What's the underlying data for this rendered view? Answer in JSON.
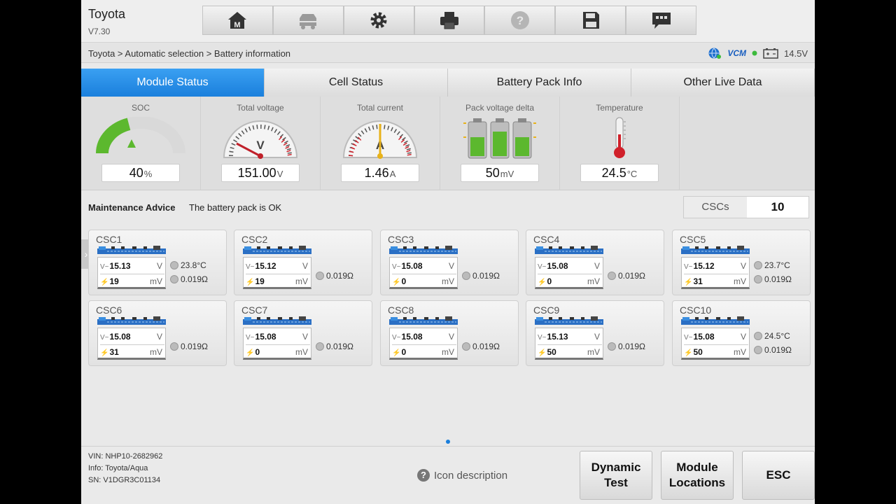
{
  "app": {
    "title": "Toyota",
    "version": "V7.30"
  },
  "toolbar": {
    "buttons": [
      {
        "icon": "home-icon"
      },
      {
        "icon": "vehicle-swap-icon"
      },
      {
        "icon": "settings-gear-icon"
      },
      {
        "icon": "printer-icon"
      },
      {
        "icon": "help-icon"
      },
      {
        "icon": "save-icon"
      },
      {
        "icon": "message-icon"
      }
    ]
  },
  "breadcrumb": "Toyota > Automatic selection > Battery information",
  "status": {
    "vcm_label": "VCM",
    "voltage": "14.5V"
  },
  "tabs": [
    {
      "label": "Module Status",
      "active": true
    },
    {
      "label": "Cell Status",
      "active": false
    },
    {
      "label": "Battery Pack Info",
      "active": false
    },
    {
      "label": "Other Live Data",
      "active": false
    }
  ],
  "gauges": {
    "soc": {
      "label": "SOC",
      "value": "40",
      "unit": "%",
      "level": 0.4
    },
    "total_voltage": {
      "label": "Total voltage",
      "value": "151.00",
      "unit": "V",
      "dial_letter": "V"
    },
    "total_current": {
      "label": "Total current",
      "value": "1.46",
      "unit": "A",
      "dial_letter": "A"
    },
    "pack_delta": {
      "label": "Pack voltage delta",
      "value": "50",
      "unit": "mV"
    },
    "temperature": {
      "label": "Temperature",
      "value": "24.5",
      "unit": "°C"
    }
  },
  "maintenance": {
    "label": "Maintenance Advice",
    "text": "The battery pack is OK"
  },
  "cscs": {
    "label": "CSCs",
    "value": "10"
  },
  "csc_cards": [
    {
      "name": "CSC1",
      "voltage": "15.13",
      "volt_unit": "V",
      "delta": "19",
      "delta_unit": "mV",
      "temp": "23.8°C",
      "resistance": "0.019Ω"
    },
    {
      "name": "CSC2",
      "voltage": "15.12",
      "volt_unit": "V",
      "delta": "19",
      "delta_unit": "mV",
      "temp": "",
      "resistance": "0.019Ω"
    },
    {
      "name": "CSC3",
      "voltage": "15.08",
      "volt_unit": "V",
      "delta": "0",
      "delta_unit": "mV",
      "temp": "",
      "resistance": "0.019Ω"
    },
    {
      "name": "CSC4",
      "voltage": "15.08",
      "volt_unit": "V",
      "delta": "0",
      "delta_unit": "mV",
      "temp": "",
      "resistance": "0.019Ω"
    },
    {
      "name": "CSC5",
      "voltage": "15.12",
      "volt_unit": "V",
      "delta": "31",
      "delta_unit": "mV",
      "temp": "23.7°C",
      "resistance": "0.019Ω"
    },
    {
      "name": "CSC6",
      "voltage": "15.08",
      "volt_unit": "V",
      "delta": "31",
      "delta_unit": "mV",
      "temp": "",
      "resistance": "0.019Ω"
    },
    {
      "name": "CSC7",
      "voltage": "15.08",
      "volt_unit": "V",
      "delta": "0",
      "delta_unit": "mV",
      "temp": "",
      "resistance": "0.019Ω"
    },
    {
      "name": "CSC8",
      "voltage": "15.08",
      "volt_unit": "V",
      "delta": "0",
      "delta_unit": "mV",
      "temp": "",
      "resistance": "0.019Ω"
    },
    {
      "name": "CSC9",
      "voltage": "15.13",
      "volt_unit": "V",
      "delta": "50",
      "delta_unit": "mV",
      "temp": "",
      "resistance": "0.019Ω"
    },
    {
      "name": "CSC10",
      "voltage": "15.08",
      "volt_unit": "V",
      "delta": "50",
      "delta_unit": "mV",
      "temp": "24.5°C",
      "resistance": "0.019Ω"
    }
  ],
  "vehicle": {
    "vin": "VIN: NHP10-2682962",
    "info": "Info: Toyota/Aqua",
    "sn": "SN: V1DGR3C01134"
  },
  "footer": {
    "icon_description": "Icon description",
    "buttons": {
      "dynamic_test": "Dynamic\nTest",
      "module_locations": "Module\nLocations",
      "esc": "ESC"
    }
  },
  "colors": {
    "accent": "#1a7fdc",
    "good": "#5cb82e",
    "thermo": "#d0202a"
  }
}
